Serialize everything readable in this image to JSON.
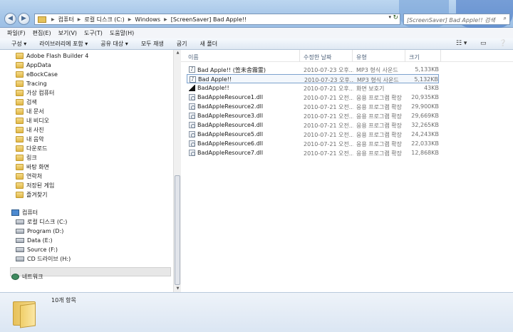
{
  "address": {
    "crumbs": [
      "컴퓨터",
      "로컬 디스크 (C:)",
      "Windows",
      "[ScreenSaver] Bad Apple!!"
    ]
  },
  "search": {
    "placeholder": "[ScreenSaver] Bad Apple!! 검색"
  },
  "menu": [
    "파일(F)",
    "편집(E)",
    "보기(V)",
    "도구(T)",
    "도움말(H)"
  ],
  "toolbar": [
    "구성 ▾",
    "라이브러리에 포함 ▾",
    "공유 대상 ▾",
    "모두 재생",
    "굽기",
    "새 폴더"
  ],
  "nav_folders": [
    {
      "label": "Adobe Flash Builder 4",
      "icon": "folder-icon"
    },
    {
      "label": "AppData",
      "icon": "folder-icon"
    },
    {
      "label": "eBockCase",
      "icon": "folder-icon"
    },
    {
      "label": "Tracing",
      "icon": "folder-icon"
    },
    {
      "label": "가상 컴퓨터",
      "icon": "folder-icon"
    },
    {
      "label": "검색",
      "icon": "folder-icon"
    },
    {
      "label": "내 문서",
      "icon": "folder-icon"
    },
    {
      "label": "내 비디오",
      "icon": "folder-icon"
    },
    {
      "label": "내 사진",
      "icon": "folder-icon"
    },
    {
      "label": "내 음악",
      "icon": "folder-icon"
    },
    {
      "label": "다운로드",
      "icon": "folder-icon"
    },
    {
      "label": "링크",
      "icon": "folder-icon"
    },
    {
      "label": "바탕 화면",
      "icon": "folder-icon"
    },
    {
      "label": "연락처",
      "icon": "folder-icon"
    },
    {
      "label": "저장된 게임",
      "icon": "folder-icon"
    },
    {
      "label": "즐겨찾기",
      "icon": "folder-icon"
    }
  ],
  "nav_computer": {
    "label": "컴퓨터",
    "icon": "computer-icon"
  },
  "nav_drives": [
    {
      "label": "로컬 디스크 (C:)",
      "icon": "drive-icon"
    },
    {
      "label": "Program (D:)",
      "icon": "drive-icon"
    },
    {
      "label": "Data (E:)",
      "icon": "drive-icon"
    },
    {
      "label": "Source (F:)",
      "icon": "drive-icon"
    },
    {
      "label": "CD 드라이브 (H:)",
      "icon": "cd-drive-icon"
    }
  ],
  "nav_network": {
    "label": "네트워크",
    "icon": "network-icon"
  },
  "columns": {
    "name": "이름",
    "date": "수정한 날짜",
    "type": "유형",
    "size": "크기"
  },
  "files": [
    {
      "name": "Bad Apple!! (笠未舎霧霊)",
      "date": "2010-07-23 오후...",
      "type": "MP3 형식 사운드",
      "size": "5,133KB",
      "icon": "mp3"
    },
    {
      "name": "Bad Apple!!",
      "date": "2010-07-23 오후...",
      "type": "MP3 형식 사운드",
      "size": "5,132KB",
      "icon": "mp3"
    },
    {
      "name": "BadApple!!",
      "date": "2010-07-21 오후...",
      "type": "화면 보호기",
      "size": "43KB",
      "icon": "scr"
    },
    {
      "name": "BadAppleResource1.dll",
      "date": "2010-07-21 오전...",
      "type": "응용 프로그램 확장",
      "size": "20,935KB",
      "icon": "dll"
    },
    {
      "name": "BadAppleResource2.dll",
      "date": "2010-07-21 오전...",
      "type": "응용 프로그램 확장",
      "size": "29,900KB",
      "icon": "dll"
    },
    {
      "name": "BadAppleResource3.dll",
      "date": "2010-07-21 오전...",
      "type": "응용 프로그램 확장",
      "size": "29,669KB",
      "icon": "dll"
    },
    {
      "name": "BadAppleResource4.dll",
      "date": "2010-07-21 오전...",
      "type": "응용 프로그램 확장",
      "size": "32,265KB",
      "icon": "dll"
    },
    {
      "name": "BadAppleResource5.dll",
      "date": "2010-07-21 오전...",
      "type": "응용 프로그램 확장",
      "size": "24,243KB",
      "icon": "dll"
    },
    {
      "name": "BadAppleResource6.dll",
      "date": "2010-07-21 오전...",
      "type": "응용 프로그램 확장",
      "size": "22,033KB",
      "icon": "dll"
    },
    {
      "name": "BadAppleResource7.dll",
      "date": "2010-07-21 오전...",
      "type": "응용 프로그램 확장",
      "size": "12,868KB",
      "icon": "dll"
    }
  ],
  "status": {
    "item_count": "10개 항목"
  },
  "colors": {
    "accent": "#7da2ce",
    "titlebar": "#a6c6e8"
  }
}
